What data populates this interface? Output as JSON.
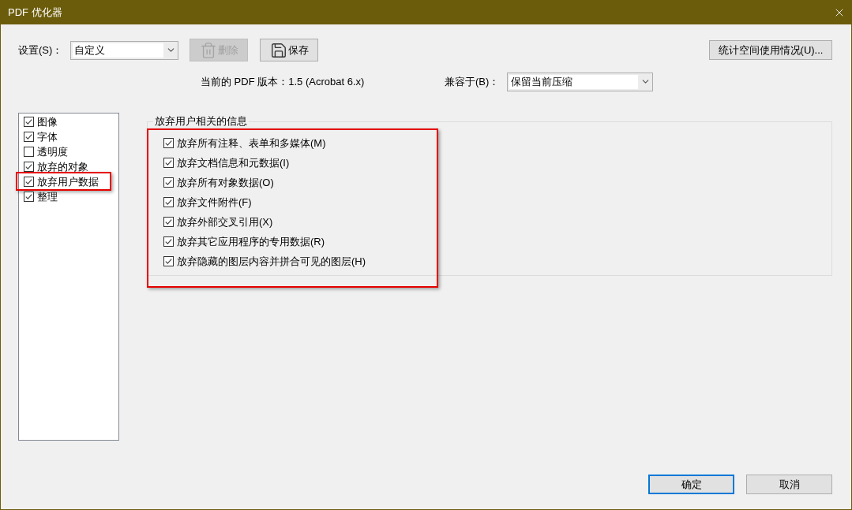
{
  "window": {
    "title": "PDF 优化器"
  },
  "settings": {
    "label": "设置(S)：",
    "value": "自定义"
  },
  "toolbar_buttons": [
    {
      "label": "删除",
      "kind": "delete",
      "disabled": true
    },
    {
      "label": "保存",
      "kind": "save",
      "disabled": false
    }
  ],
  "audit_button": {
    "label": "统计空间使用情况(U)..."
  },
  "version_text": "当前的 PDF 版本：1.5 (Acrobat 6.x)",
  "compatibility": {
    "label": "兼容于(B)：",
    "value": "保留当前压缩"
  },
  "sidebar": {
    "items": [
      {
        "label": "图像",
        "checked": true,
        "highlighted": false
      },
      {
        "label": "字体",
        "checked": true,
        "highlighted": false
      },
      {
        "label": "透明度",
        "checked": false,
        "highlighted": false
      },
      {
        "label": "放弃的对象",
        "checked": true,
        "highlighted": false
      },
      {
        "label": "放弃用户数据",
        "checked": true,
        "highlighted": true
      },
      {
        "label": "整理",
        "checked": true,
        "highlighted": false
      }
    ]
  },
  "panel": {
    "title": "放弃用户相关的信息",
    "highlighted": true,
    "options": [
      {
        "label": "放弃所有注释、表单和多媒体(M)",
        "checked": true
      },
      {
        "label": "放弃文档信息和元数据(I)",
        "checked": true
      },
      {
        "label": "放弃所有对象数据(O)",
        "checked": true
      },
      {
        "label": "放弃文件附件(F)",
        "checked": true
      },
      {
        "label": "放弃外部交叉引用(X)",
        "checked": true
      },
      {
        "label": "放弃其它应用程序的专用数据(R)",
        "checked": true
      },
      {
        "label": "放弃隐藏的图层内容并拼合可见的图层(H)",
        "checked": true
      }
    ]
  },
  "footer_buttons": [
    {
      "label": "确定",
      "default": true
    },
    {
      "label": "取消",
      "default": false
    }
  ]
}
